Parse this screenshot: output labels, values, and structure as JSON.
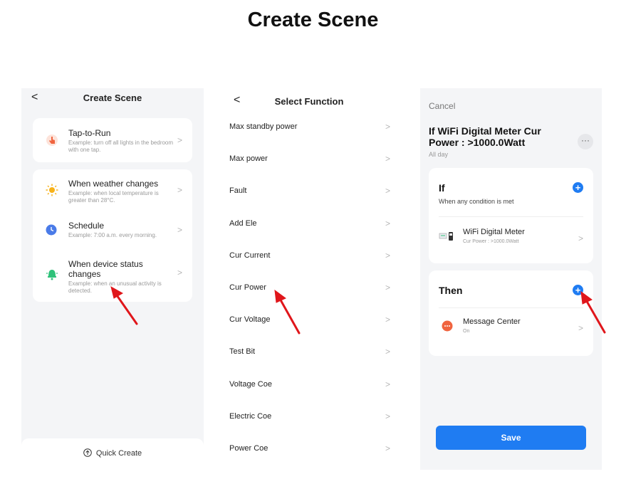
{
  "page": {
    "title": "Create Scene"
  },
  "panel1": {
    "back": "<",
    "title": "Create Scene",
    "tap_to_run": {
      "title": "Tap-to-Run",
      "desc": "Example: turn off all lights in the bedroom with one tap."
    },
    "weather": {
      "title": "When weather changes",
      "desc": "Example: when local temperature is greater than 28°C."
    },
    "schedule": {
      "title": "Schedule",
      "desc": "Example: 7:00 a.m. every morning."
    },
    "device": {
      "title": "When device status changes",
      "desc": "Example: when an unusual activity is detected."
    },
    "quick_create": "Quick Create",
    "chevron": ">"
  },
  "panel2": {
    "back": "<",
    "title": "Select Function",
    "chevron": ">",
    "functions": [
      "Max standby power",
      "Max power",
      "Fault",
      "Add Ele",
      "Cur Current",
      "Cur Power",
      "Cur Voltage",
      "Test Bit",
      "Voltage Coe",
      "Electric Coe",
      "Power Coe"
    ]
  },
  "panel3": {
    "cancel": "Cancel",
    "scene_name": "If WiFi Digital Meter Cur Power : >1000.0Watt",
    "all_day": "All day",
    "more": "···",
    "if_title": "If",
    "if_sub": "When any condition is met",
    "condition": {
      "name": "WiFi Digital Meter",
      "detail": "Cur Power : >1000.0Watt"
    },
    "then_title": "Then",
    "action": {
      "name": "Message Center",
      "detail": "On"
    },
    "plus": "+",
    "chevron": ">",
    "save": "Save"
  },
  "colors": {
    "accent": "#1f7cf2",
    "arrow": "#e0161b",
    "panel_bg": "#f4f5f7"
  },
  "icons": [
    "hand-tap-icon",
    "sun-icon",
    "clock-icon",
    "device-status-icon",
    "meter-icon",
    "message-icon",
    "quick-create-icon",
    "plus-icon",
    "more-icon"
  ]
}
